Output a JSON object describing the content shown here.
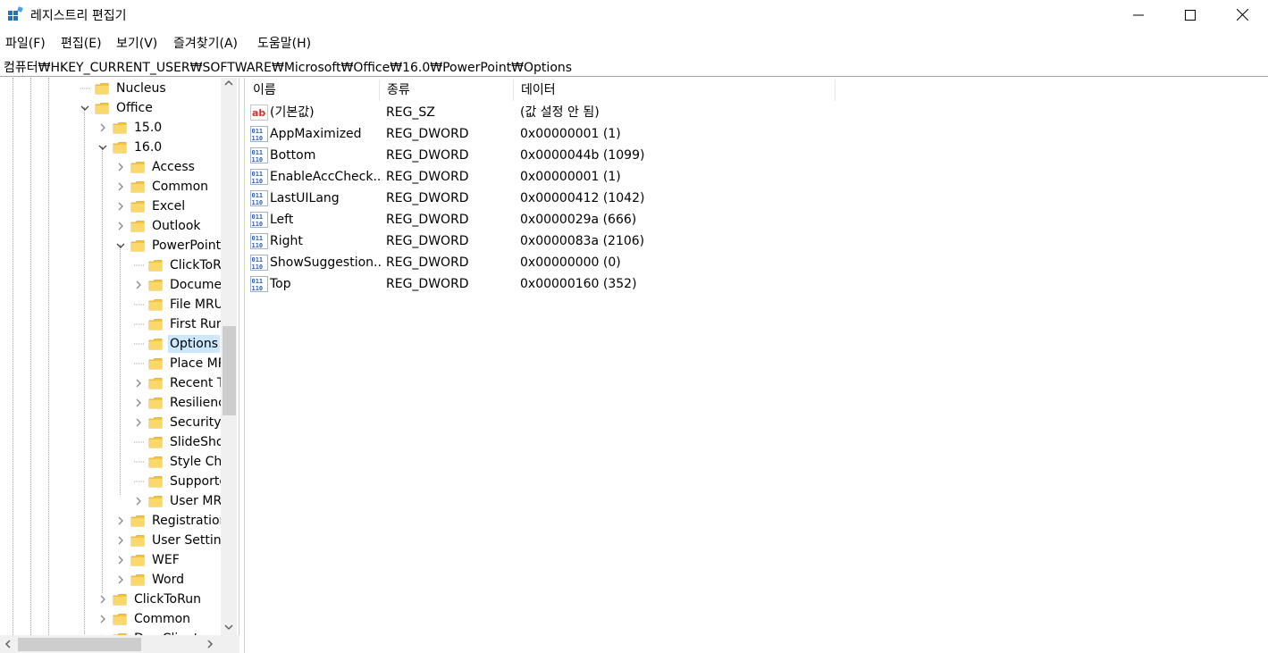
{
  "window": {
    "title": "레지스트리 편집기",
    "minimize_glyph": "—",
    "maximize_glyph": "☐",
    "close_glyph": "✕"
  },
  "menu": [
    "파일(F)",
    "편집(E)",
    "보기(V)",
    "즐겨찾기(A)",
    "도움말(H)"
  ],
  "address": "컴퓨터₩HKEY_CURRENT_USER₩SOFTWARE₩Microsoft₩Office₩16.0₩PowerPoint₩Options",
  "tree": [
    {
      "label": "Nucleus",
      "expander": ""
    },
    {
      "label": "Office",
      "expander": "open"
    },
    {
      "label": "15.0",
      "expander": "closed"
    },
    {
      "label": "16.0",
      "expander": "open"
    },
    {
      "label": "Access",
      "expander": "closed"
    },
    {
      "label": "Common",
      "expander": "closed"
    },
    {
      "label": "Excel",
      "expander": "closed"
    },
    {
      "label": "Outlook",
      "expander": "closed"
    },
    {
      "label": "PowerPoint",
      "expander": "open"
    },
    {
      "label": "ClickToR",
      "expander": ""
    },
    {
      "label": "Docume",
      "expander": "closed"
    },
    {
      "label": "File MRU",
      "expander": ""
    },
    {
      "label": "First Run",
      "expander": ""
    },
    {
      "label": "Options",
      "expander": "",
      "selected": true
    },
    {
      "label": "Place MR",
      "expander": ""
    },
    {
      "label": "Recent T",
      "expander": "closed"
    },
    {
      "label": "Resilienc",
      "expander": "closed"
    },
    {
      "label": "Security",
      "expander": "closed"
    },
    {
      "label": "SlideSho",
      "expander": ""
    },
    {
      "label": "Style Ch",
      "expander": ""
    },
    {
      "label": "Supporte",
      "expander": ""
    },
    {
      "label": "User MR",
      "expander": "closed"
    },
    {
      "label": "Registration",
      "expander": "closed"
    },
    {
      "label": "User Setting",
      "expander": "closed"
    },
    {
      "label": "WEF",
      "expander": "closed"
    },
    {
      "label": "Word",
      "expander": "closed"
    },
    {
      "label": "ClickToRun",
      "expander": "closed"
    },
    {
      "label": "Common",
      "expander": "closed"
    },
    {
      "label": "DmsClient",
      "expander": "closed"
    }
  ],
  "columns": [
    "이름",
    "종류",
    "데이터"
  ],
  "values": [
    {
      "name": "(기본값)",
      "type": "REG_SZ",
      "data": "(값 설정 안 됨)",
      "icon": "string-value-icon"
    },
    {
      "name": "AppMaximized",
      "type": "REG_DWORD",
      "data": "0x00000001 (1)",
      "icon": "dword-value-icon"
    },
    {
      "name": "Bottom",
      "type": "REG_DWORD",
      "data": "0x0000044b (1099)",
      "icon": "dword-value-icon"
    },
    {
      "name": "EnableAccCheck...",
      "type": "REG_DWORD",
      "data": "0x00000001 (1)",
      "icon": "dword-value-icon"
    },
    {
      "name": "LastUILang",
      "type": "REG_DWORD",
      "data": "0x00000412 (1042)",
      "icon": "dword-value-icon"
    },
    {
      "name": "Left",
      "type": "REG_DWORD",
      "data": "0x0000029a (666)",
      "icon": "dword-value-icon"
    },
    {
      "name": "Right",
      "type": "REG_DWORD",
      "data": "0x0000083a (2106)",
      "icon": "dword-value-icon"
    },
    {
      "name": "ShowSuggestion...",
      "type": "REG_DWORD",
      "data": "0x00000000 (0)",
      "icon": "dword-value-icon"
    },
    {
      "name": "Top",
      "type": "REG_DWORD",
      "data": "0x00000160 (352)",
      "icon": "dword-value-icon"
    }
  ],
  "colors": {
    "selection": "#cce8ff",
    "folder": "#f5c542",
    "icon_blue": "#2e5fa8",
    "icon_red": "#c0392b"
  }
}
